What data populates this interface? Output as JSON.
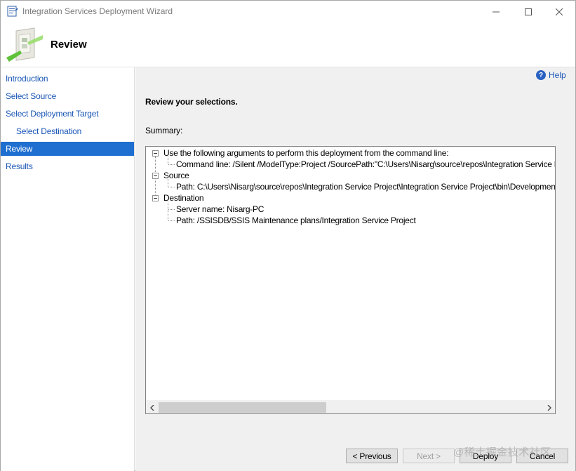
{
  "window": {
    "title": "Integration Services Deployment Wizard"
  },
  "header": {
    "title": "Review"
  },
  "nav": {
    "items": [
      {
        "label": "Introduction"
      },
      {
        "label": "Select Source"
      },
      {
        "label": "Select Deployment Target"
      },
      {
        "label": "Select Destination"
      },
      {
        "label": "Review"
      },
      {
        "label": "Results"
      }
    ]
  },
  "content": {
    "help_label": "Help",
    "heading": "Review your selections.",
    "summary_label": "Summary:"
  },
  "tree": {
    "nodes": [
      {
        "label": "Use the following arguments to perform this deployment from the command line:"
      },
      {
        "label": "Command line: /Silent /ModelType:Project /SourcePath:\"C:\\Users\\Nisarg\\source\\repos\\Integration Service Proje"
      },
      {
        "label": "Source"
      },
      {
        "label": "Path: C:\\Users\\Nisarg\\source\\repos\\Integration Service Project\\Integration Service Project\\bin\\Development\\Inte"
      },
      {
        "label": "Destination"
      },
      {
        "label": "Server name: Nisarg-PC"
      },
      {
        "label": "Path: /SSISDB/SSIS Maintenance plans/Integration Service Project"
      }
    ]
  },
  "buttons": {
    "previous": "< Previous",
    "next": "Next >",
    "deploy": "Deploy",
    "cancel": "Cancel"
  },
  "watermark": "@稀土掘金技术社区",
  "colors": {
    "accent": "#1f6fd1",
    "link": "#1a56b5",
    "content_bg": "#f0f0f0"
  }
}
